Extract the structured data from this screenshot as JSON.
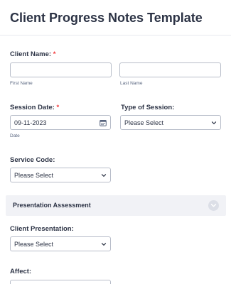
{
  "form": {
    "title": "Client Progress Notes Template"
  },
  "client_name": {
    "label": "Client Name:",
    "required_mark": "*",
    "first_sublabel": "First Name",
    "last_sublabel": "Last Name",
    "first_value": "",
    "last_value": ""
  },
  "session_date": {
    "label": "Session Date:",
    "required_mark": "*",
    "value": "09-11-2023",
    "sublabel": "Date"
  },
  "type_of_session": {
    "label": "Type of Session:",
    "selected": "Please Select"
  },
  "service_code": {
    "label": "Service Code:",
    "selected": "Please Select"
  },
  "presentation_section": {
    "title": "Presentation Assessment"
  },
  "client_presentation": {
    "label": "Client Presentation:",
    "selected": "Please Select"
  },
  "affect": {
    "label": "Affect:"
  },
  "icons": {
    "calendar": "calendar-icon",
    "chevron": "chevron-down-icon",
    "collapse": "collapse-section-icon"
  }
}
